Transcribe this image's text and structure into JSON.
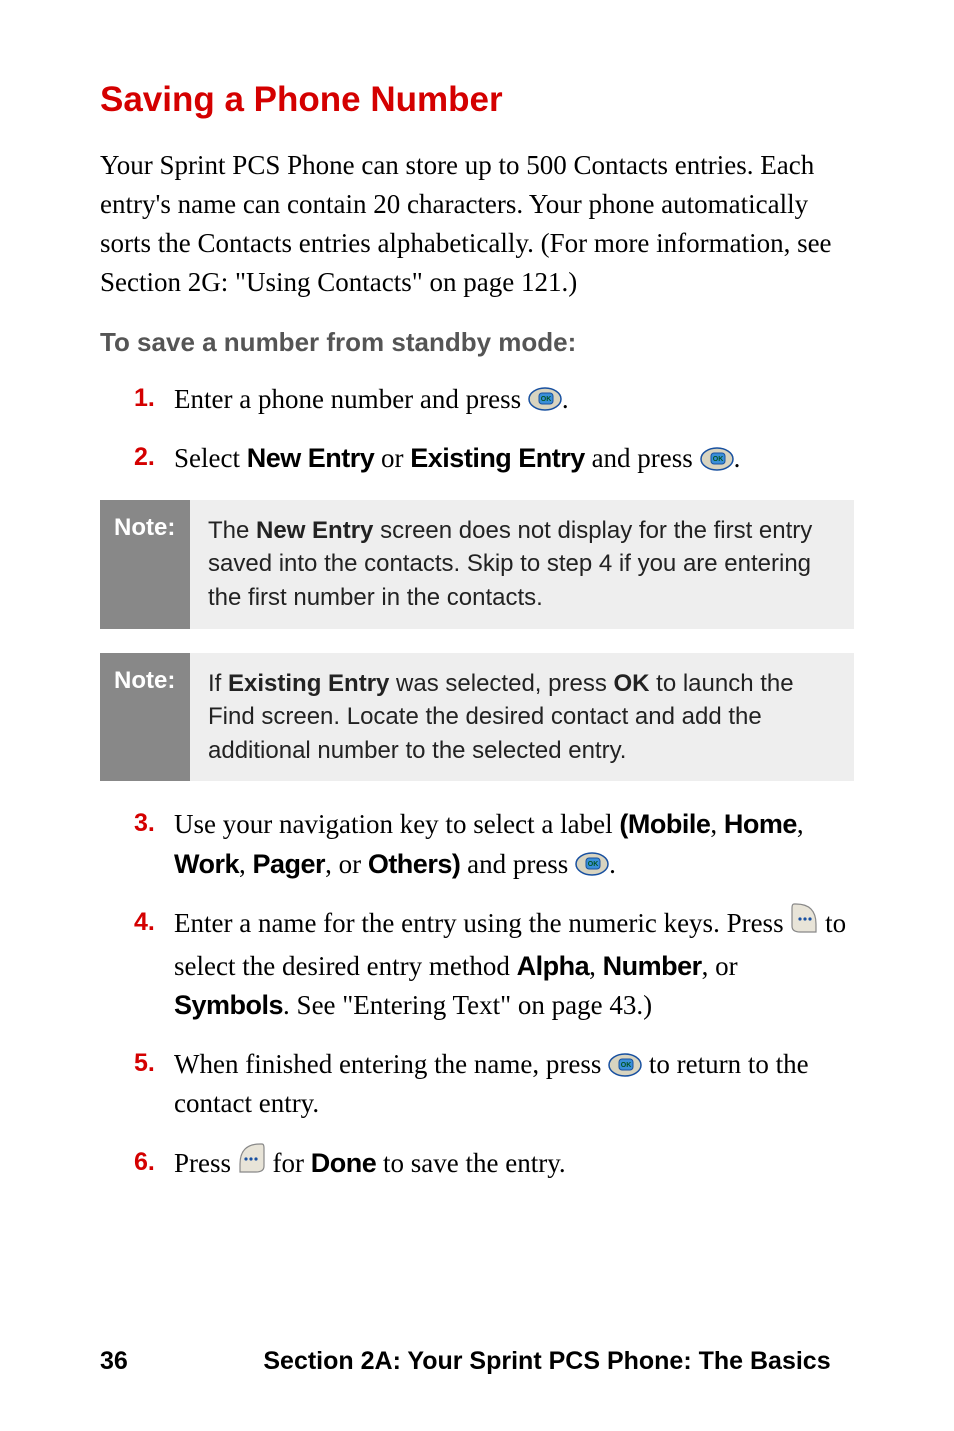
{
  "heading": "Saving a Phone Number",
  "intro": "Your Sprint PCS Phone can store up to 500 Contacts entries. Each entry's name can contain 20 characters. Your phone automatically sorts the Contacts entries alphabetically. (For more information, see Section 2G: \"Using Contacts\" on page 121.)",
  "subheading": "To save a number from standby mode:",
  "steps_a": {
    "s1": {
      "num": "1.",
      "pre": "Enter a phone number and press ",
      "post": "."
    },
    "s2": {
      "num": "2.",
      "pre": "Select ",
      "b1": "New Entry",
      "mid1": " or ",
      "b2": "Existing Entry",
      "mid2": " and press ",
      "post": "."
    }
  },
  "note1": {
    "label": "Note:",
    "pre": "The ",
    "bold": "New Entry",
    "post": " screen does not display for the first entry saved into the contacts. Skip to step 4 if you are entering the first number in the contacts."
  },
  "note2": {
    "label": "Note:",
    "pre": "If ",
    "bold1": "Existing Entry",
    "mid1": " was selected, press ",
    "bold2": "OK",
    "post": " to launch the Find screen. Locate the desired contact and add the additional number to the selected entry."
  },
  "steps_b": {
    "s3": {
      "num": "3.",
      "pre": "Use your navigation key to select a label ",
      "b_open": "(Mobile",
      "c1": ", ",
      "b2": "Home",
      "c2": ", ",
      "b3": "Work",
      "c3": ", ",
      "b4": "Pager",
      "c4": ", or ",
      "b5": "Others)",
      "mid": " and press ",
      "post": "."
    },
    "s4": {
      "num": "4.",
      "l1": "Enter a name for the entry using the numeric keys. Press ",
      "l2": " to select the desired entry method ",
      "b1": "Alpha",
      "c1": ", ",
      "b2": "Number",
      "c2": ", or ",
      "b3": "Symbols",
      "l3": ". See \"Entering Text\" on page 43.)"
    },
    "s5": {
      "num": "5.",
      "pre": "When finished entering the name, press ",
      "post": " to return to the contact entry."
    },
    "s6": {
      "num": "6.",
      "pre": "Press ",
      "mid": " for ",
      "b1": "Done",
      "post": " to save the entry."
    }
  },
  "footer": {
    "page": "36",
    "section": "Section 2A: Your Sprint PCS Phone: The Basics"
  }
}
